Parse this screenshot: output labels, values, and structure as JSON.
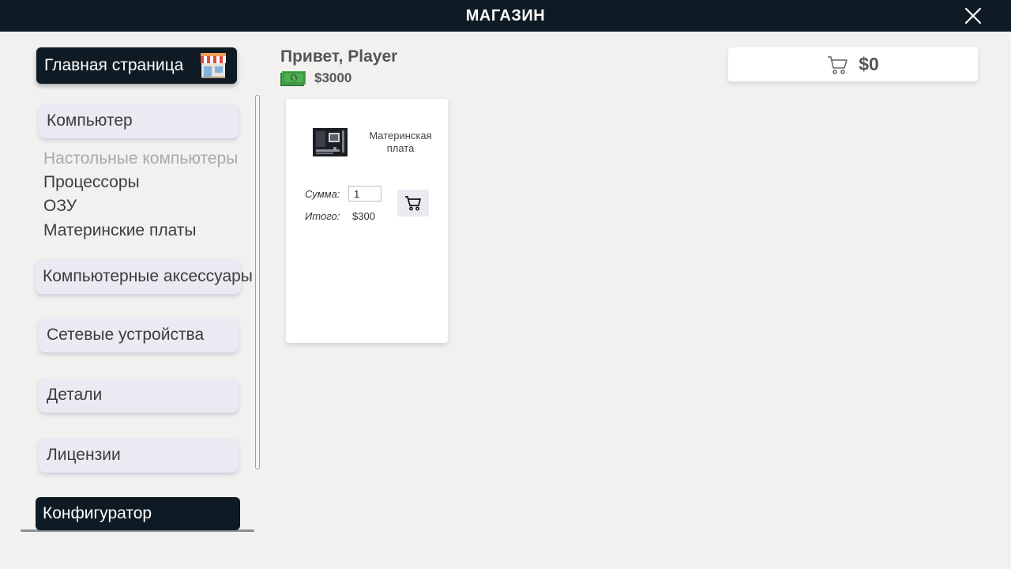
{
  "window": {
    "title": "МАГАЗИН"
  },
  "sidebar": {
    "home_label": "Главная страница",
    "categories": [
      {
        "label": "Компьютер"
      },
      {
        "label": "Компьютерные аксессуары"
      },
      {
        "label": "Сетевые устройства"
      },
      {
        "label": "Детали"
      },
      {
        "label": "Лицензии"
      }
    ],
    "subitems": [
      {
        "label": "Настольные компьютеры",
        "state": "disabled"
      },
      {
        "label": "Процессоры"
      },
      {
        "label": "ОЗУ"
      },
      {
        "label": "Материнские платы"
      }
    ],
    "configurator_label": "Конфигуратор"
  },
  "header": {
    "greeting": "Привет, Player",
    "balance": "$3000",
    "cart_total": "$0"
  },
  "products": [
    {
      "name": "Материнская плата",
      "qty_label": "Сумма:",
      "qty_value": "1",
      "total_label": "Итого:",
      "total_value": "$300"
    }
  ],
  "colors": {
    "titlebar": "#0f1b24",
    "background": "#f2f1ef",
    "button_light": "#e9eaf2",
    "money_green": "#3e9a45"
  },
  "icons": {
    "close": "close-icon",
    "shop": "shop-icon",
    "money": "money-icon",
    "cart": "cart-icon"
  }
}
